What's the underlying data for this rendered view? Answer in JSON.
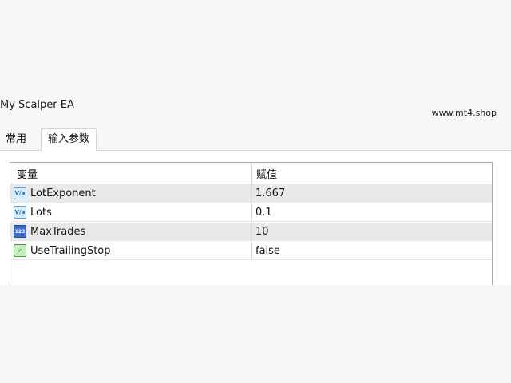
{
  "window": {
    "ea_title": "My Scalper EA",
    "watermark": "www.mt4.shop"
  },
  "tabs": [
    {
      "label": "常用",
      "active": false
    },
    {
      "label": "输入参数",
      "active": true
    }
  ],
  "table": {
    "headers": {
      "variable": "变量",
      "value": "赋值"
    },
    "rows": [
      {
        "icon": "double-value-icon",
        "icon_glyph": "V/a",
        "name": "LotExponent",
        "value": "1.667"
      },
      {
        "icon": "double-value-icon",
        "icon_glyph": "V/a",
        "name": "Lots",
        "value": "0.1"
      },
      {
        "icon": "integer-value-icon",
        "icon_glyph": "123",
        "name": "MaxTrades",
        "value": "10"
      },
      {
        "icon": "boolean-value-icon",
        "icon_glyph": "✓",
        "name": "UseTrailingStop",
        "value": "false"
      }
    ]
  }
}
